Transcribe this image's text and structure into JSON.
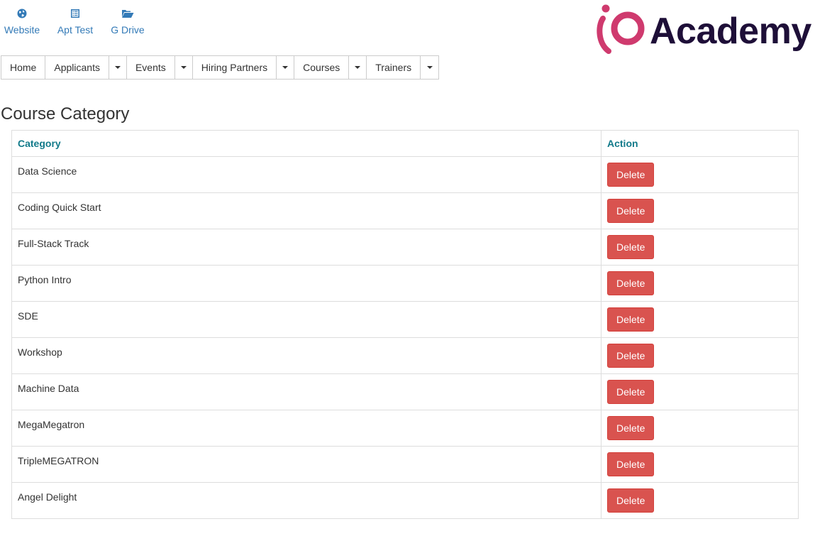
{
  "quick_links": [
    {
      "label": "Website",
      "icon": "globe-icon"
    },
    {
      "label": "Apt Test",
      "icon": "list-alt-icon"
    },
    {
      "label": "G Drive",
      "icon": "folder-open-icon"
    }
  ],
  "logo": {
    "text": "Academy",
    "mark_color": "#cf3a6e",
    "text_color": "#1e0f38"
  },
  "nav": {
    "items": [
      {
        "label": "Home",
        "dropdown": false
      },
      {
        "label": "Applicants",
        "dropdown": true
      },
      {
        "label": "Events",
        "dropdown": true
      },
      {
        "label": "Hiring Partners",
        "dropdown": true
      },
      {
        "label": "Courses",
        "dropdown": true
      },
      {
        "label": "Trainers",
        "dropdown": true
      }
    ]
  },
  "page": {
    "title": "Course Category"
  },
  "table": {
    "headers": {
      "category": "Category",
      "action": "Action"
    },
    "delete_label": "Delete",
    "rows": [
      {
        "category": "Data Science"
      },
      {
        "category": "Coding Quick Start"
      },
      {
        "category": "Full-Stack Track"
      },
      {
        "category": "Python Intro"
      },
      {
        "category": "SDE"
      },
      {
        "category": "Workshop"
      },
      {
        "category": "Machine Data"
      },
      {
        "category": "MegaMegatron"
      },
      {
        "category": "TripleMEGATRON"
      },
      {
        "category": "Angel Delight"
      }
    ]
  },
  "colors": {
    "link": "#337ab7",
    "header_text": "#127a8a",
    "danger": "#d9534f"
  }
}
